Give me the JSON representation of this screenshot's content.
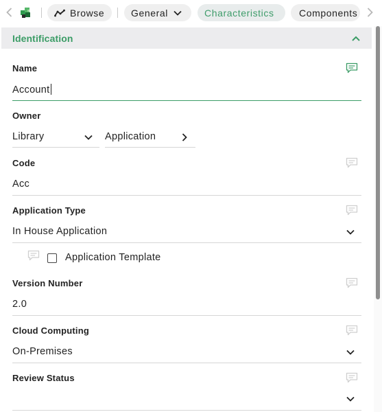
{
  "toolbar": {
    "tabs": [
      {
        "label": "Browse"
      },
      {
        "label": "General"
      },
      {
        "label": "Characteristics"
      },
      {
        "label": "Components"
      }
    ],
    "active_tab": "Characteristics",
    "accent_color": "#3b9c66"
  },
  "section": {
    "title": "Identification",
    "collapse_icon": "chevron-up-icon"
  },
  "fields": {
    "name": {
      "label": "Name",
      "value": "Account"
    },
    "owner": {
      "label": "Owner",
      "select_value": "Library",
      "link_value": "Application"
    },
    "code": {
      "label": "Code",
      "value": "Acc"
    },
    "application_type": {
      "label": "Application Type",
      "value": "In House Application"
    },
    "application_template": {
      "label": "Application Template",
      "checked": false
    },
    "version_number": {
      "label": "Version Number",
      "value": "2.0"
    },
    "cloud_computing": {
      "label": "Cloud Computing",
      "value": "On-Premises"
    },
    "review_status": {
      "label": "Review Status",
      "value": ""
    }
  },
  "icons": {
    "comment": "comment-icon",
    "back": "chevron-left-icon",
    "forward": "chevron-right-icon",
    "dropdown": "chevron-down-icon",
    "logo": "app-logo-icon",
    "browse": "trend-line-icon"
  }
}
